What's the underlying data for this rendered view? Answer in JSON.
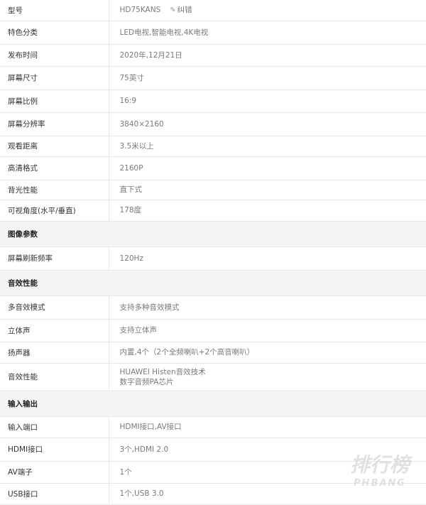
{
  "rows": [
    {
      "type": "spec",
      "label": "型号",
      "value": "HD75KANS",
      "correct_label": "纠错",
      "height": 29
    },
    {
      "type": "spec",
      "label": "特色分类",
      "value": "LED电视,智能电视,4K电视",
      "height": 33
    },
    {
      "type": "spec",
      "label": "发布时间",
      "value": "2020年,12月21日",
      "height": 31
    },
    {
      "type": "spec",
      "label": "屏幕尺寸",
      "value": "75英寸",
      "height": 33
    },
    {
      "type": "spec",
      "label": "屏幕比例",
      "value": "16:9",
      "height": 32
    },
    {
      "type": "spec",
      "label": "屏幕分辨率",
      "value": "3840×2160",
      "height": 33
    },
    {
      "type": "spec",
      "label": "观看距离",
      "value": "3.5米以上",
      "height": 29
    },
    {
      "type": "spec",
      "label": "高清格式",
      "value": "2160P",
      "height": 33
    },
    {
      "type": "spec",
      "label": "背光性能",
      "value": "直下式",
      "height": 28
    },
    {
      "type": "spec",
      "label": "可视角度(水平/垂直)",
      "value": "178度",
      "height": 30
    },
    {
      "type": "section",
      "label": "图像参数",
      "height": 36
    },
    {
      "type": "spec",
      "label": "屏幕刷新频率",
      "value": "120Hz",
      "height": 33
    },
    {
      "type": "section",
      "label": "音效性能",
      "height": 36
    },
    {
      "type": "spec",
      "label": "多音效模式",
      "value": "支持多种音效模式",
      "height": 33
    },
    {
      "type": "spec",
      "label": "立体声",
      "value": "支持立体声",
      "height": 32
    },
    {
      "type": "spec",
      "label": "扬声器",
      "value": "内置,4个（2个全频喇叭+2个高音喇叭）",
      "height": 30
    },
    {
      "type": "spec",
      "label": "音效性能",
      "value": "HUAWEI Histen音效技术",
      "value2": "数字音频PA芯片",
      "height": 39
    },
    {
      "type": "section",
      "label": "输入输出",
      "height": 36
    },
    {
      "type": "spec",
      "label": "输入端口",
      "value": "HDMI接口,AV接口",
      "height": 30
    },
    {
      "type": "spec",
      "label": "HDMI接口",
      "value": "3个,HDMI 2.0",
      "height": 33
    },
    {
      "type": "spec",
      "label": "AV端子",
      "value": "1个",
      "height": 31
    },
    {
      "type": "spec",
      "label": "USB接口",
      "value": "1个,USB 3.0",
      "height": 30
    }
  ],
  "watermark": {
    "title": "排行榜",
    "sub": "PHBANG",
    "color": "#c9c9c9"
  }
}
